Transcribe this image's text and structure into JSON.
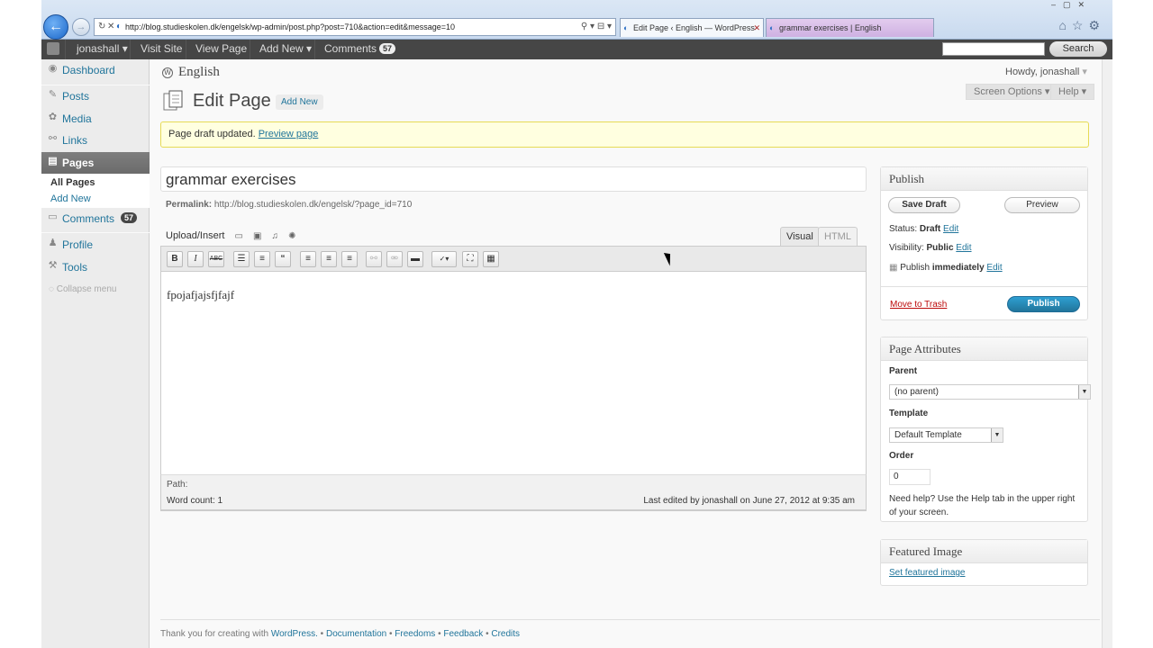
{
  "browser": {
    "url": "http://blog.studieskolen.dk/engelsk/wp-admin/post.php?post=710&action=edit&message=10",
    "tabs": [
      {
        "label": "Edit Page ‹ English — WordPress",
        "active": true
      },
      {
        "label": "grammar exercises | English",
        "active": false
      }
    ]
  },
  "adminbar": {
    "user": "jonashall ▾",
    "visit_site": "Visit Site",
    "view_page": "View Page",
    "add_new": "Add New ▾",
    "comments": "Comments",
    "comments_count": "57",
    "search_button": "Search"
  },
  "sidebar": {
    "dashboard": "Dashboard",
    "posts": "Posts",
    "media": "Media",
    "links": "Links",
    "pages": "Pages",
    "all_pages": "All Pages",
    "add_new": "Add New",
    "comments": "Comments",
    "comments_count": "57",
    "profile": "Profile",
    "tools": "Tools",
    "collapse": "Collapse menu"
  },
  "header": {
    "site_name": "English",
    "howdy": "Howdy, jonashall",
    "page_title": "Edit Page",
    "add_new": "Add New",
    "screen_options": "Screen Options ▾",
    "help": "Help ▾"
  },
  "notice": {
    "text": "Page draft updated.",
    "link": "Preview page"
  },
  "editor": {
    "title": "grammar exercises",
    "permalink_label": "Permalink:",
    "permalink_url": "http://blog.studieskolen.dk/engelsk/?page_id=710",
    "upload_insert": "Upload/Insert",
    "tab_visual": "Visual",
    "tab_html": "HTML",
    "content": "fpojafjajsfjfajf",
    "path_label": "Path:",
    "word_count": "Word count: 1",
    "last_edited": "Last edited by jonashall on June 27, 2012 at 9:35 am"
  },
  "publish": {
    "heading": "Publish",
    "save_draft": "Save Draft",
    "preview": "Preview",
    "status_label": "Status:",
    "status_value": "Draft",
    "visibility_label": "Visibility:",
    "visibility_value": "Public",
    "publish_label": "Publish",
    "publish_value": "immediately",
    "edit": "Edit",
    "move_to_trash": "Move to Trash",
    "publish_button": "Publish"
  },
  "attributes": {
    "heading": "Page Attributes",
    "parent_label": "Parent",
    "parent_value": "(no parent)",
    "template_label": "Template",
    "template_value": "Default Template",
    "order_label": "Order",
    "order_value": "0",
    "help_text": "Need help? Use the Help tab in the upper right of your screen."
  },
  "featured": {
    "heading": "Featured Image",
    "link": "Set featured image"
  },
  "footer": {
    "thanks": "Thank you for creating with",
    "wordpress": "WordPress.",
    "documentation": "Documentation",
    "freedoms": "Freedoms",
    "feedback": "Feedback",
    "credits": "Credits"
  },
  "colors": {
    "link": "#21759b",
    "adminbar": "#464646",
    "notice_bg": "#ffffe0",
    "publish_btn": "#21759b",
    "trash": "#bc0b0b"
  }
}
